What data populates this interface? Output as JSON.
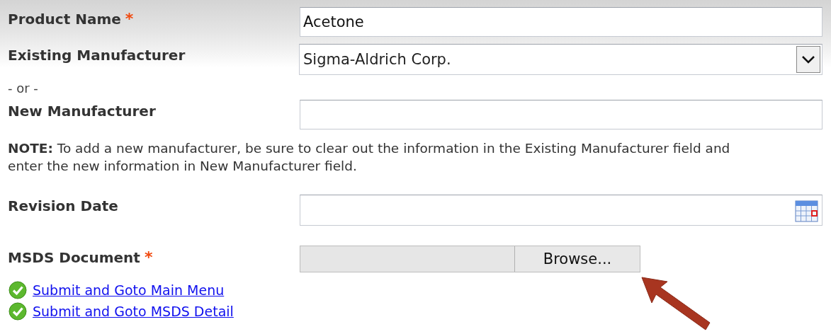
{
  "form": {
    "rows": [
      {
        "kind": "text",
        "label": "Product Name",
        "required_mark": "*",
        "value": "Acetone",
        "highlighted": true
      },
      {
        "kind": "select",
        "label": "Existing Manufacturer",
        "value": "Sigma-Aldrich Corp.",
        "highlighted": true
      },
      {
        "kind": "separator",
        "label": "- or -",
        "highlighted": false
      },
      {
        "kind": "text",
        "label": "New Manufacturer",
        "highlighted": false
      },
      {
        "kind": "note",
        "text": "**NOTE:** To add a new manufacturer, be sure to clear out the information in the Existing Manufacturer field and enter the new information in New Manufacturer field.",
        "highlighted": false
      },
      {
        "kind": "date",
        "label": "Revision Date",
        "highlighted": false
      },
      {
        "kind": "file",
        "label": "MSDS Document",
        "required_mark": "*",
        "button": "Browse...",
        "highlighted": false
      }
    ]
  },
  "links": [
    {
      "label": "Submit and Goto Main Menu"
    },
    {
      "label": "Submit and Goto MSDS Detail"
    }
  ]
}
